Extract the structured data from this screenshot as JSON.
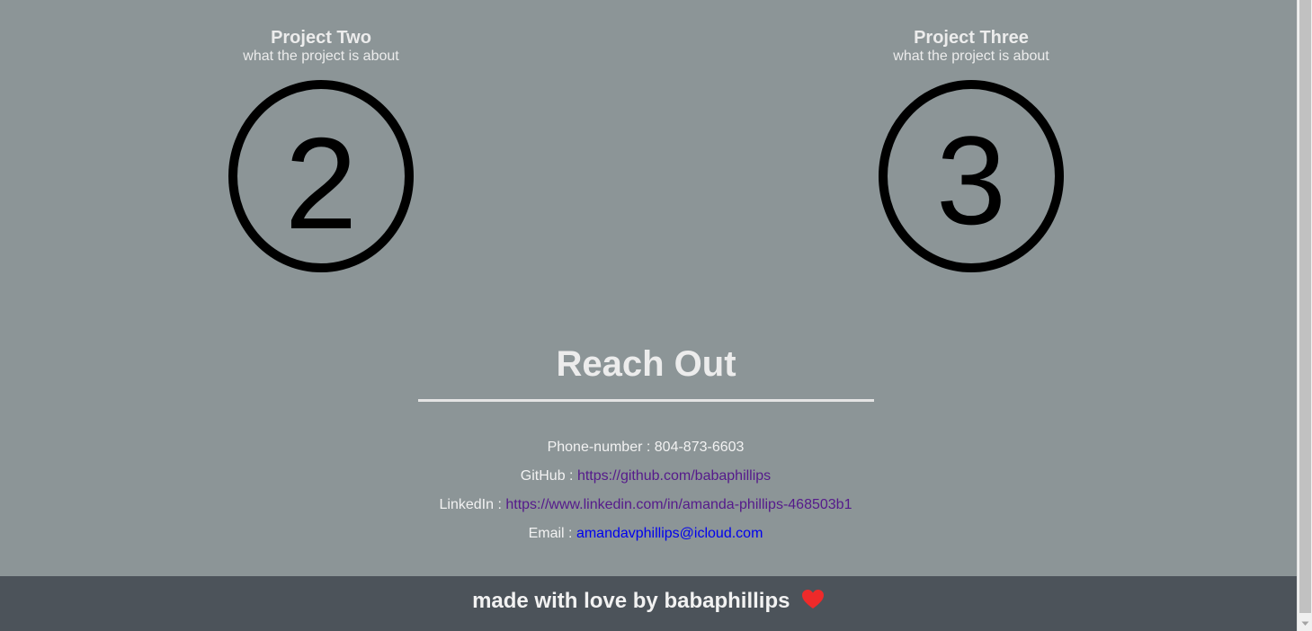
{
  "projects": [
    {
      "title": "Project Two",
      "description": "what the project is about",
      "numeral": "2"
    },
    {
      "title": "Project Three",
      "description": "what the project is about",
      "numeral": "3"
    }
  ],
  "reach_out": {
    "title": "Reach Out",
    "contacts": [
      {
        "label": "Phone-number : ",
        "value": "804-873-6603"
      },
      {
        "label": "GitHub : ",
        "value": "https://github.com/babaphillips"
      },
      {
        "label": "LinkedIn : ",
        "value": "https://www.linkedin.com/in/amanda-phillips-468503b1"
      },
      {
        "label": "Email : ",
        "value": "amandavphillips@icloud.com"
      }
    ]
  },
  "footer": {
    "text": "made with love by babaphillips",
    "icon": "heart-icon"
  },
  "colors": {
    "page_background": "#8c9597",
    "footer_background": "#4c535a",
    "visited_link": "#551a8b",
    "link": "#0000ee",
    "heart": "#ee2a2a"
  }
}
